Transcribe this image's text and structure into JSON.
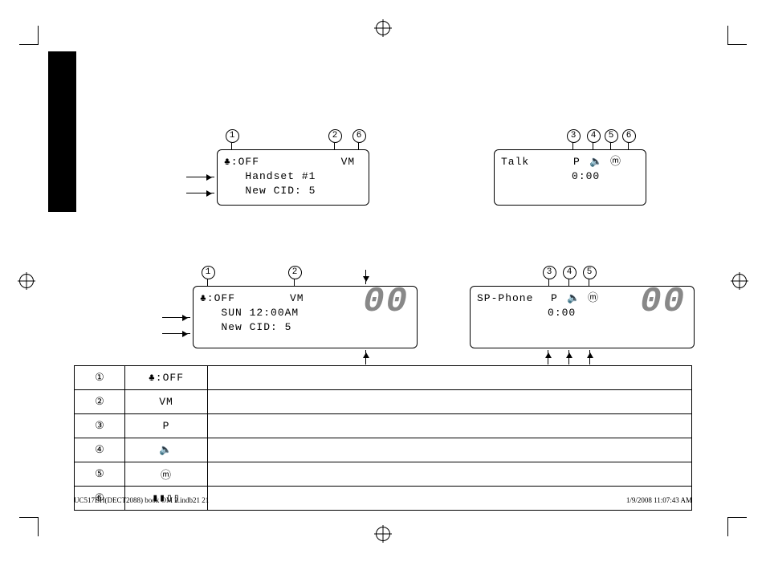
{
  "callouts": {
    "c1": "1",
    "c2": "2",
    "c3": "3",
    "c4": "4",
    "c5": "5",
    "c6": "6"
  },
  "lcd1": {
    "line1_left": "♣:OFF",
    "line1_right": "VM ",
    "line2": "   Handset #1",
    "line3": "   New CID: 5"
  },
  "lcd2": {
    "line1_left": "Talk",
    "line1_mid": "P ",
    "line1_icons": "🔈 ⓜ",
    "line2": "          0:00"
  },
  "lcd3": {
    "line1_left": "♣:OFF",
    "line1_right": "VM",
    "line2": "   SUN 12:00AM",
    "line3": "   New CID: 5",
    "seg": "00"
  },
  "lcd4": {
    "line1_left": "SP-Phone",
    "line1_mid": "P ",
    "line1_icons": "🔈 ⓜ",
    "line2": "          0:00",
    "seg": "00"
  },
  "legend": [
    {
      "num": "①",
      "sym": "♣:OFF"
    },
    {
      "num": "②",
      "sym": "VM"
    },
    {
      "num": "③",
      "sym": "P"
    },
    {
      "num": "④",
      "sym": "🔈"
    },
    {
      "num": "⑤",
      "sym": "ⓜ"
    },
    {
      "num": "⑥",
      "sym": "▮▮▯▯"
    }
  ],
  "footer": {
    "left": "UC517BH(DECT2088) book OM 2.indb21   21",
    "right": "1/9/2008   11:07:43 AM"
  }
}
